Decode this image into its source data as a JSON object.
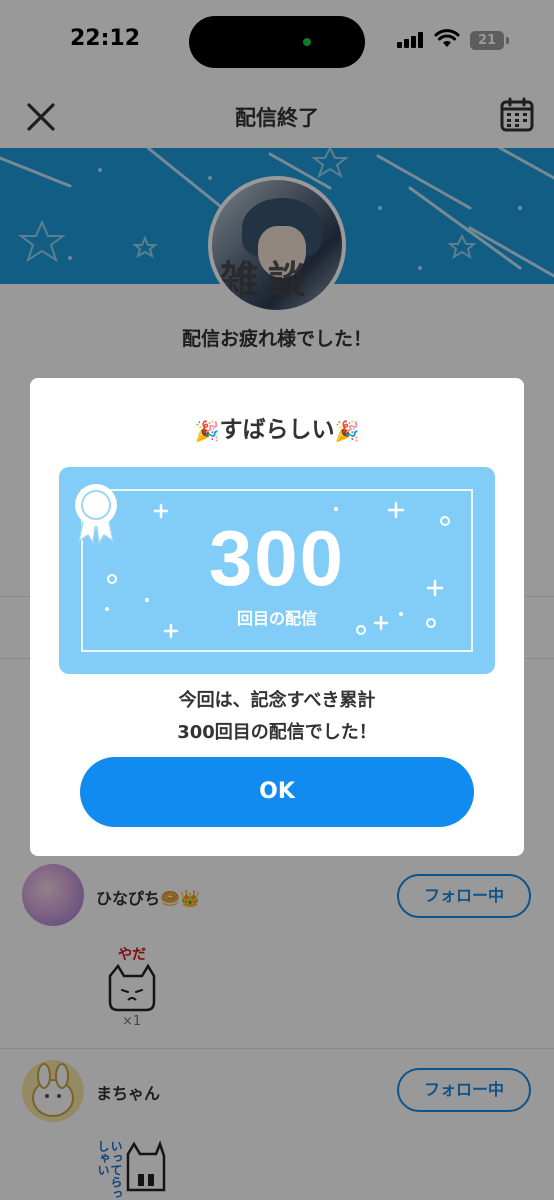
{
  "status_bar": {
    "time": "22:12",
    "battery": "21"
  },
  "header": {
    "title": "配信終了"
  },
  "summary": {
    "thanks_text": "配信お疲れ様でした！",
    "avatar_caption": "雑談"
  },
  "viewers": [
    {
      "name": "ひなぴち",
      "emoji": "🥯👑",
      "follow_label": "フォロー中",
      "gift_label": "やだ",
      "gift_count": "×1"
    },
    {
      "name": "まちゃん",
      "follow_label": "フォロー中",
      "gift_label": "いってらっしゃい"
    }
  ],
  "modal": {
    "title": "すばらしい",
    "title_emoji": "🎉",
    "milestone_number": "300",
    "milestone_sub": "回目の配信",
    "message_line1": "今回は、記念すべき累計",
    "message_line2": "300回目の配信でした！",
    "ok_label": "OK"
  },
  "colors": {
    "accent": "#128bf0",
    "banner": "#1e9bdc",
    "card": "#82cdf8",
    "follow": "#1a8ae8"
  }
}
